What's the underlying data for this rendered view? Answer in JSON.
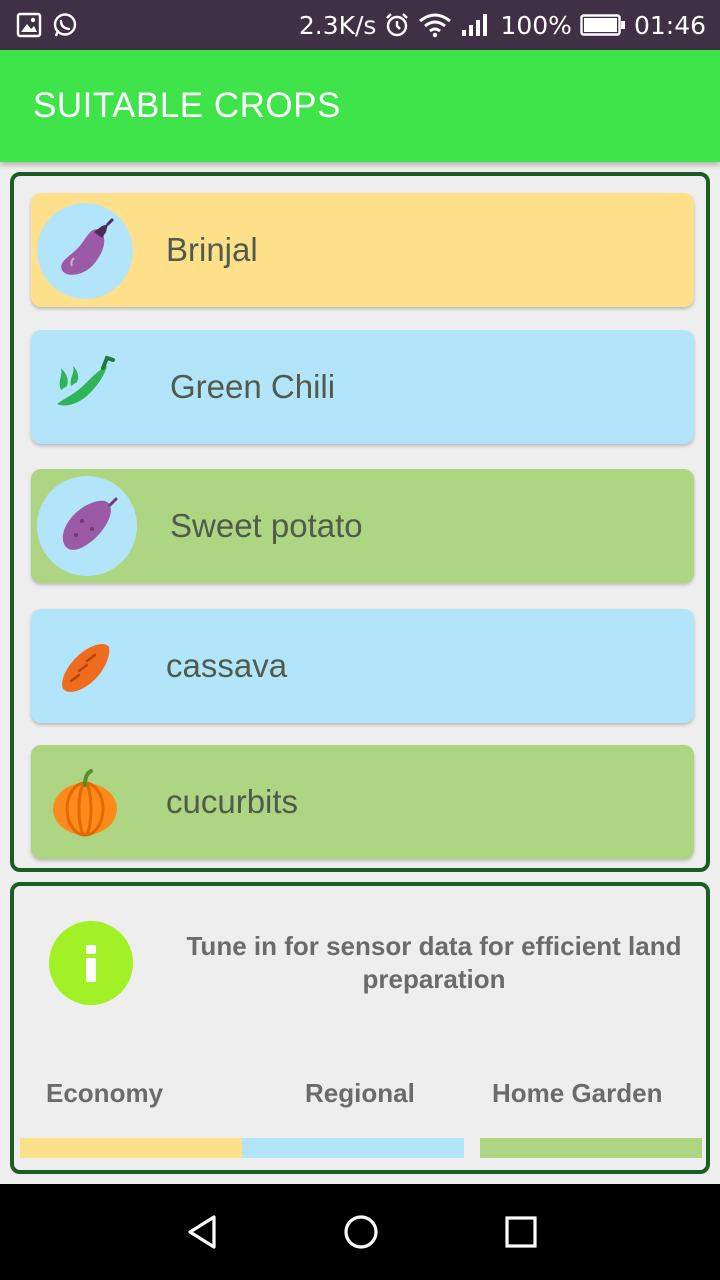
{
  "status_bar": {
    "speed": "2.3K/s",
    "battery": "100%",
    "time": "01:46",
    "icons": [
      "gallery-icon",
      "whatsapp-icon",
      "alarm-icon",
      "wifi-icon",
      "signal-icon",
      "battery-icon"
    ]
  },
  "app_bar": {
    "title": "SUITABLE CROPS",
    "color": "#3fe34a"
  },
  "crops": [
    {
      "label": "Brinjal",
      "icon": "eggplant-icon",
      "color": "#ffe08a"
    },
    {
      "label": "Green Chili",
      "icon": "chili-icon",
      "color": "#b3e5fa"
    },
    {
      "label": "Sweet potato",
      "icon": "sweet-potato-icon",
      "color": "#aed581"
    },
    {
      "label": "cassava",
      "icon": "cassava-icon",
      "color": "#b3e5fa"
    },
    {
      "label": "cucurbits",
      "icon": "pumpkin-icon",
      "color": "#aed581"
    }
  ],
  "info": {
    "icon": "info-icon",
    "message": "Tune in for sensor data for efficient land preparation"
  },
  "legend": [
    {
      "label": "Economy",
      "color": "#ffe08a"
    },
    {
      "label": "Regional",
      "color": "#b3e5fa"
    },
    {
      "label": "Home Garden",
      "color": "#aed581"
    }
  ],
  "nav": [
    "back-icon",
    "home-icon",
    "recents-icon"
  ]
}
